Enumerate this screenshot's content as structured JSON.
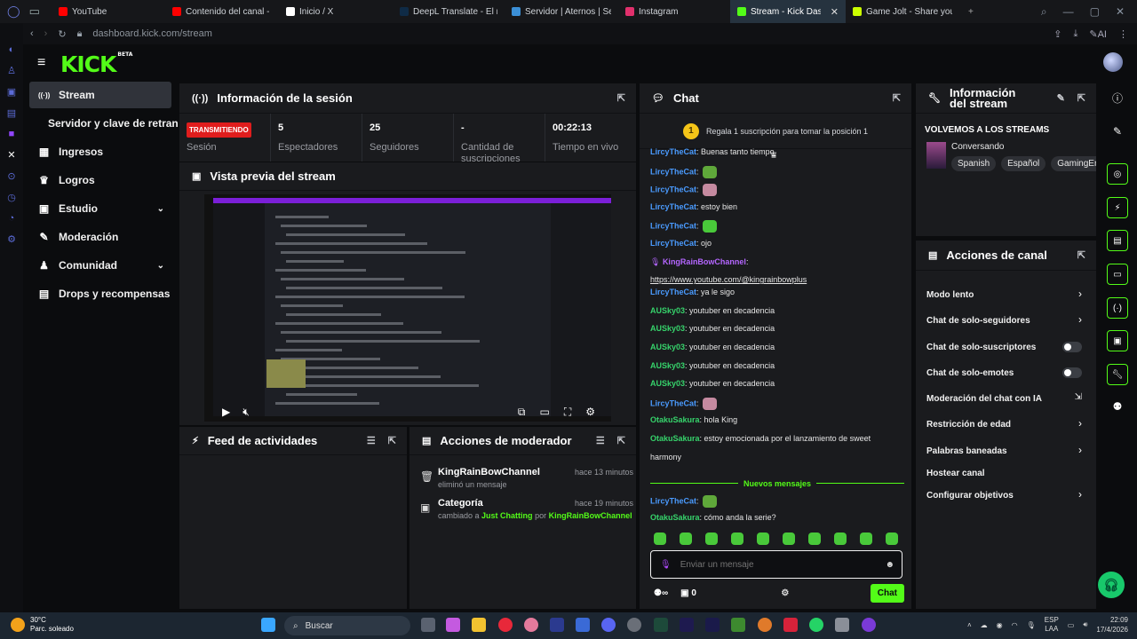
{
  "browser": {
    "tabs": [
      {
        "label": "YouTube",
        "color": "#ff0000"
      },
      {
        "label": "Contenido del canal - You",
        "color": "#ff0000"
      },
      {
        "label": "Inicio / X",
        "color": "#ffffff"
      },
      {
        "label": "DeepL Translate - El mejor",
        "color": "#0f2b46"
      },
      {
        "label": "Servidor | Aternos | Servid",
        "color": "#3b8fd6"
      },
      {
        "label": "Instagram",
        "color": "#e1306c"
      },
      {
        "label": "Stream - Kick Dashboard",
        "color": "#53fc18"
      },
      {
        "label": "Game Jolt - Share your cre",
        "color": "#ccff00"
      }
    ],
    "url": "dashboard.kick.com/stream",
    "ai_label": "AI"
  },
  "app": {
    "logo": "KICK",
    "logo_badge": "BETA"
  },
  "nav": {
    "items": [
      {
        "label": "Stream",
        "icon": "broadcast-icon",
        "glyph": "((·))"
      },
      {
        "label": "Ingresos",
        "icon": "chart-icon",
        "glyph": "▦"
      },
      {
        "label": "Logros",
        "icon": "trophy-icon",
        "glyph": "♛"
      },
      {
        "label": "Estudio",
        "icon": "studio-icon",
        "glyph": "▣"
      },
      {
        "label": "Moderación",
        "icon": "wrench-icon",
        "glyph": "✎"
      },
      {
        "label": "Comunidad",
        "icon": "community-icon",
        "glyph": "♟"
      },
      {
        "label": "Drops y recompensas",
        "icon": "drops-icon",
        "glyph": "▤"
      }
    ],
    "sub_item": "Servidor y clave de retransmisión"
  },
  "session": {
    "title": "Información de la sesión",
    "status_badge": "TRANSMITIENDO",
    "stats": [
      {
        "value": "",
        "label": "Sesión"
      },
      {
        "value": "5",
        "label": "Espectadores"
      },
      {
        "value": "25",
        "label": "Seguidores"
      },
      {
        "value": "-",
        "label": "Cantidad de suscripciones"
      },
      {
        "value": "00:22:13",
        "label": "Tiempo en vivo"
      }
    ]
  },
  "preview": {
    "title": "Vista previa del stream"
  },
  "activity": {
    "title": "Feed de actividades"
  },
  "mod_actions": {
    "title": "Acciones de moderador",
    "rows": [
      {
        "who": "KingRainBowChannel",
        "when": "hace 13 minutos",
        "what": "eliminó un mensaje",
        "extra_pre": "",
        "extra_mid": "",
        "extra_by": "",
        "extra_user": ""
      },
      {
        "who": "Categoría",
        "when": "hace 19 minutos",
        "what": "cambiado a",
        "extra_mid": "Just Chatting",
        "extra_by": "por",
        "extra_user": "KingRainBowChannel"
      }
    ]
  },
  "chat": {
    "title": "Chat",
    "sub_banner": "Regala 1 suscripción para tomar la posición 1",
    "sub_coin": "1",
    "messages": [
      {
        "user": "LircyTheCat",
        "text": "Buenas tanto tiempo",
        "color": "#4a9bff"
      },
      {
        "user": "LircyTheCat",
        "text": "",
        "emote": true,
        "color": "#4a9bff"
      },
      {
        "user": "LircyTheCat",
        "text": "",
        "emote": true,
        "color": "#4a9bff"
      },
      {
        "user": "LircyTheCat",
        "text": "estoy bien",
        "color": "#4a9bff"
      },
      {
        "user": "LircyTheCat",
        "text": "",
        "emote": true,
        "color": "#4a9bff"
      },
      {
        "user": "LircyTheCat",
        "text": "ojo",
        "color": "#4a9bff"
      },
      {
        "user": "KingRainBowChannel",
        "text": "",
        "color": "#b466ff"
      },
      {
        "user": "",
        "text": "https://www.youtube.com/@kingrainbowplus",
        "color": "#e6e6e6"
      },
      {
        "user": "LircyTheCat",
        "text": "ya le sigo",
        "color": "#4a9bff"
      },
      {
        "user": "AUSky03",
        "text": "youtuber en decadencia",
        "color": "#36d36b"
      },
      {
        "user": "AUSky03",
        "text": "youtuber en decadencia",
        "color": "#36d36b"
      },
      {
        "user": "AUSky03",
        "text": "youtuber en decadencia",
        "color": "#36d36b"
      },
      {
        "user": "AUSky03",
        "text": "youtuber en decadencia",
        "color": "#36d36b"
      },
      {
        "user": "AUSky03",
        "text": "youtuber en decadencia",
        "color": "#36d36b"
      },
      {
        "user": "LircyTheCat",
        "text": "",
        "emote": true,
        "color": "#4a9bff"
      },
      {
        "user": "OtakuSakura",
        "text": "hola King",
        "color": "#36d36b"
      },
      {
        "user": "OtakuSakura",
        "text": "estoy emocionada por el lanzamiento de sweet",
        "color": "#36d36b"
      },
      {
        "user": "",
        "text": "harmony",
        "color": "#e6e6e6"
      }
    ],
    "new_messages": "Nuevos mensajes",
    "after": [
      {
        "user": "LircyTheCat",
        "text": "",
        "emote": true,
        "color": "#4a9bff"
      },
      {
        "user": "OtakuSakura",
        "text": "cómo anda la serie?",
        "color": "#36d36b"
      }
    ],
    "input_placeholder": "Enviar un mensaje",
    "points": "0",
    "send_label": "Chat"
  },
  "stream_info": {
    "title": "Información del stream",
    "stream_title": "VOLVEMOS A LOS STREAMS",
    "category": "Conversando",
    "tags": [
      "Spanish",
      "Español",
      "GamingEnEspañol"
    ]
  },
  "channel_actions": {
    "title": "Acciones de canal",
    "items": [
      {
        "label": "Modo lento",
        "control": "chevron"
      },
      {
        "label": "Chat de solo-seguidores",
        "control": "chevron"
      },
      {
        "label": "Chat de solo-suscriptores",
        "control": "toggle"
      },
      {
        "label": "Chat de solo-emotes",
        "control": "toggle"
      },
      {
        "label": "Moderación del chat con IA",
        "control": "external"
      },
      {
        "label": "Restricción de edad",
        "control": "chevron"
      },
      {
        "label": "Palabras baneadas",
        "control": "chevron"
      },
      {
        "label": "Hostear canal",
        "control": "none"
      },
      {
        "label": "Configurar objetivos",
        "control": "chevron"
      }
    ]
  },
  "taskbar": {
    "temp": "30°C",
    "weather": "Parc. soleado",
    "search": "Buscar",
    "lang1": "ESP",
    "lang2": "LAA",
    "time": "22:09",
    "date": "17/4/2026"
  }
}
